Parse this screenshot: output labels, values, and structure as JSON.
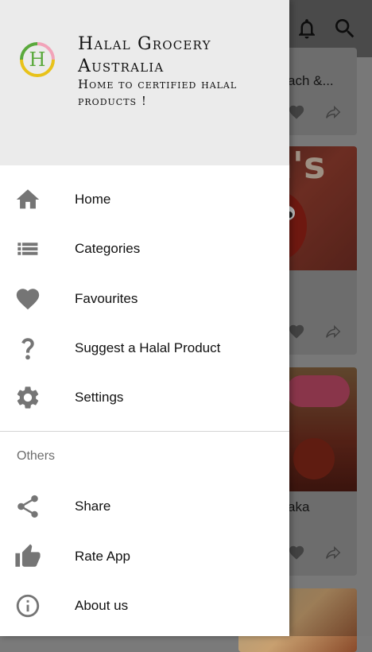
{
  "drawer": {
    "app_title": "Halal Grocery Australia",
    "app_subtitle": "Home to certified halal products !",
    "logo_letter": "H",
    "menu": [
      {
        "label": "Home",
        "icon": "home-icon"
      },
      {
        "label": "Categories",
        "icon": "list-icon"
      },
      {
        "label": "Favourites",
        "icon": "heart-icon"
      },
      {
        "label": "Suggest a Halal Product",
        "icon": "help-icon"
      },
      {
        "label": "Settings",
        "icon": "gear-icon"
      }
    ],
    "others_title": "Others",
    "others": [
      {
        "label": "Share",
        "icon": "share-icon"
      },
      {
        "label": "Rate App",
        "icon": "thumbs-up-icon"
      },
      {
        "label": "About us",
        "icon": "info-icon"
      }
    ]
  },
  "background": {
    "cards": [
      {
        "title": "ach &..."
      },
      {
        "title": ""
      },
      {
        "title": "aka"
      }
    ]
  },
  "colors": {
    "icon_gray": "#757575",
    "header_bg": "#ebebeb",
    "logo_green": "#5aa93c",
    "logo_yellow": "#e8c21a",
    "logo_pink": "#f2a3b9"
  }
}
